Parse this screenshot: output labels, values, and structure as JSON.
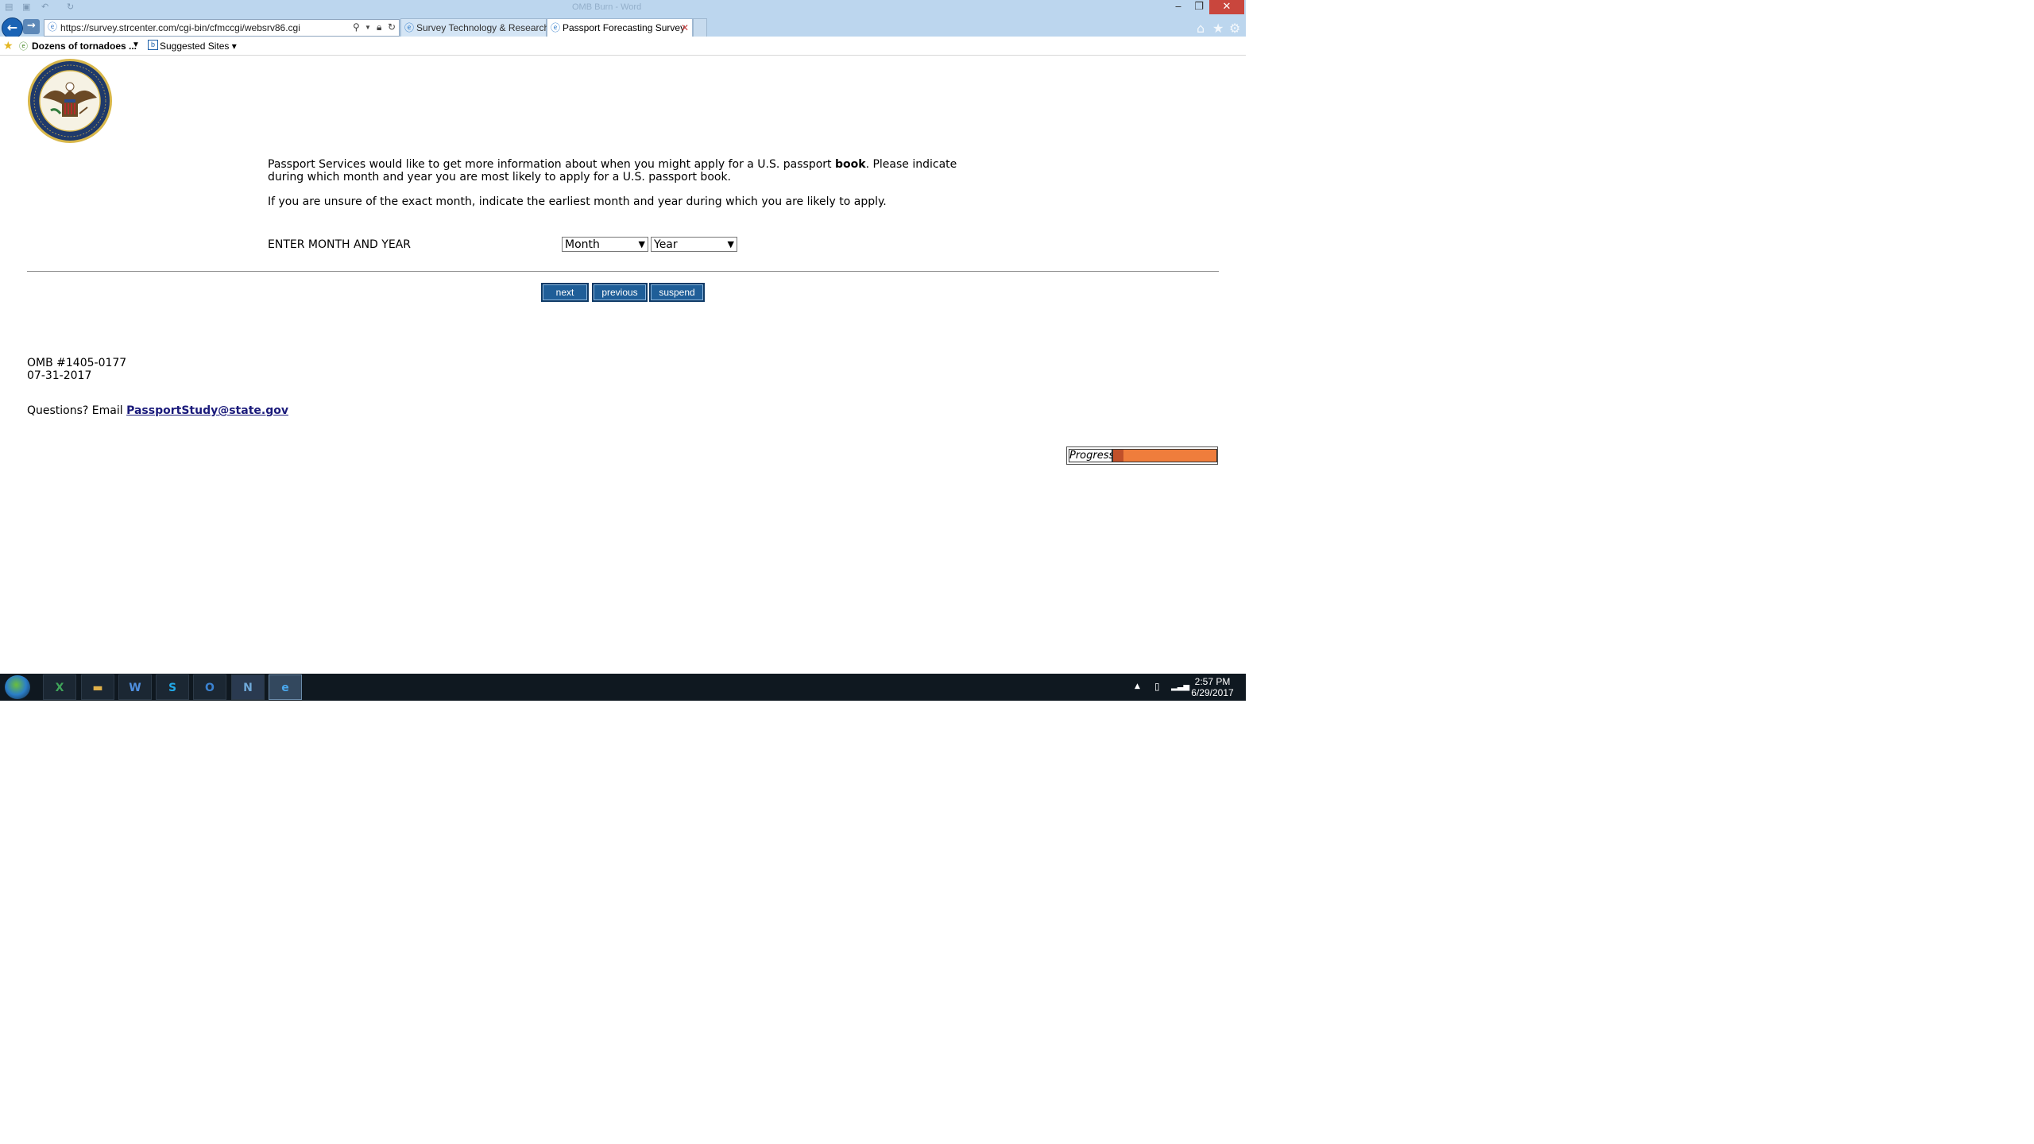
{
  "window": {
    "title": "OMB Burn - Word"
  },
  "browser": {
    "address": "https://survey.strcenter.com/cgi-bin/cfmccgi/websrv86.cgi",
    "tabs": [
      {
        "label": "Survey Technology & Research ..."
      },
      {
        "label": "Passport Forecasting Survey"
      }
    ],
    "favorites": [
      {
        "label": "Dozens of tornadoes ..."
      },
      {
        "label": "Suggested Sites"
      }
    ]
  },
  "page": {
    "intro_before_bold": "Passport Services would like to get more information about when you might apply for a U.S. passport ",
    "intro_bold": "book",
    "intro_after_bold": ". Please indicate during which month and year you are most likely to apply for a U.S. passport book.",
    "intro_2": "If you are unsure of the exact month, indicate the earliest month and year during which you are likely to apply.",
    "enter_label": "ENTER MONTH AND YEAR",
    "month_value": "Month",
    "year_value": "Year",
    "buttons": {
      "next": "next",
      "previous": "previous",
      "suspend": "suspend"
    },
    "omb_number": "OMB #1405-0177",
    "omb_date": "07-31-2017",
    "questions_label": "Questions? Email ",
    "email": "PassportStudy@state.gov",
    "progress_label": "Progress",
    "progress_value": 0.1
  },
  "taskbar": {
    "apps": [
      "excel",
      "file-explorer",
      "word",
      "skype",
      "outlook",
      "n-app",
      "internet-explorer"
    ],
    "time": "2:57 PM",
    "date": "6/29/2017"
  },
  "colors": {
    "chrome": "#bcd6ee",
    "button": "#1f5e98",
    "progress": "#ef7d3c",
    "progress_fill": "#c0502a"
  }
}
